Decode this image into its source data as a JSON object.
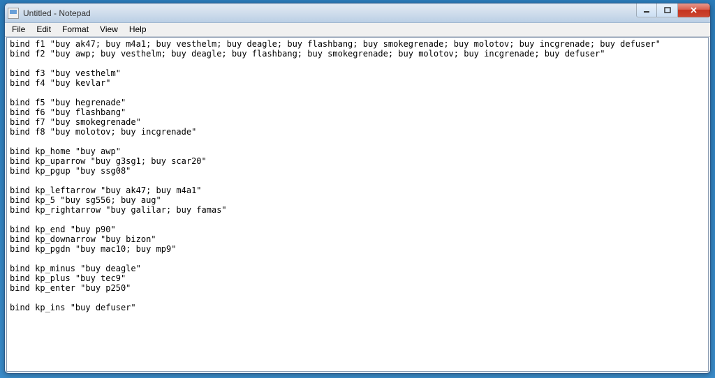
{
  "window": {
    "title": "Untitled - Notepad"
  },
  "menu": {
    "file": "File",
    "edit": "Edit",
    "format": "Format",
    "view": "View",
    "help": "Help"
  },
  "content": {
    "text": "bind f1 \"buy ak47; buy m4a1; buy vesthelm; buy deagle; buy flashbang; buy smokegrenade; buy molotov; buy incgrenade; buy defuser\"\nbind f2 \"buy awp; buy vesthelm; buy deagle; buy flashbang; buy smokegrenade; buy molotov; buy incgrenade; buy defuser\"\n\nbind f3 \"buy vesthelm\"\nbind f4 \"buy kevlar\"\n\nbind f5 \"buy hegrenade\"\nbind f6 \"buy flashbang\"\nbind f7 \"buy smokegrenade\"\nbind f8 \"buy molotov; buy incgrenade\"\n\nbind kp_home \"buy awp\"\nbind kp_uparrow \"buy g3sg1; buy scar20\"\nbind kp_pgup \"buy ssg08\"\n\nbind kp_leftarrow \"buy ak47; buy m4a1\"\nbind kp_5 \"buy sg556; buy aug\"\nbind kp_rightarrow \"buy galilar; buy famas\"\n\nbind kp_end \"buy p90\"\nbind kp_downarrow \"buy bizon\"\nbind kp_pgdn \"buy mac10; buy mp9\"\n\nbind kp_minus \"buy deagle\"\nbind kp_plus \"buy tec9\"\nbind kp_enter \"buy p250\"\n\nbind kp_ins \"buy defuser\""
  }
}
